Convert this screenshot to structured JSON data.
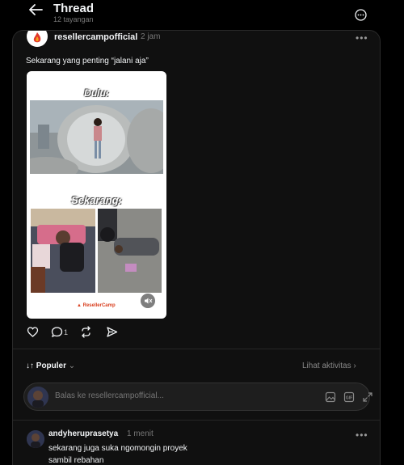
{
  "header": {
    "title": "Thread",
    "views": "12 tayangan"
  },
  "post": {
    "username": "resellercampofficial",
    "time": "2 jam",
    "caption": "Sekarang yang penting “jalani aja”",
    "media": {
      "label_top": "Dulu:",
      "label_bottom": "Sekarang:",
      "brand": "ResellerCamp"
    },
    "reply_count": "1"
  },
  "sort": {
    "label": "Populer",
    "activity_link": "Lihat aktivitas"
  },
  "reply_box": {
    "placeholder": "Balas ke resellercampofficial..."
  },
  "comment": {
    "username": "andyheruprasetya",
    "time": "1 menit",
    "text_line1": "sekarang juga suka ngomongin proyek",
    "text_line2": "sambil rebahan"
  }
}
